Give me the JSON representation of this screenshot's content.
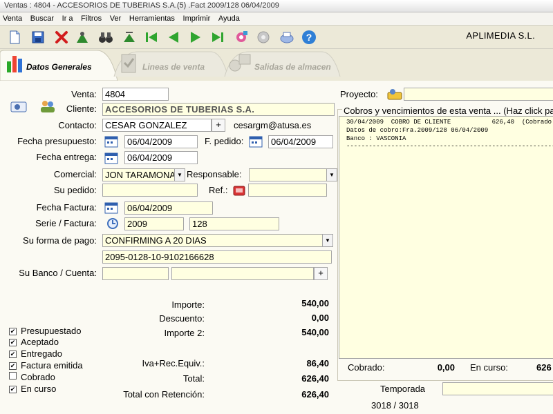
{
  "window": {
    "title": "Ventas : 4804 - ACCESORIOS DE TUBERIAS S.A.(5)    .Fact 2009/128 06/04/2009"
  },
  "menu": [
    "Venta",
    "Buscar",
    "Ir a",
    "Filtros",
    "Ver",
    "Herramientas",
    "Imprimir",
    "Ayuda"
  ],
  "toolbar": {
    "company": "APLIMEDIA S.L.",
    "buttons": [
      "new-document-icon",
      "save-icon",
      "delete-icon",
      "navigate-icon",
      "search-binoculars-icon",
      "go-icon",
      "first-record-icon",
      "previous-record-icon",
      "next-record-icon",
      "last-record-icon",
      "tools-icon",
      "settings-icon",
      "print-icon",
      "help-icon"
    ]
  },
  "tabs": [
    {
      "label": "Datos Generales",
      "active": true
    },
    {
      "label": "Lineas de venta",
      "active": false
    },
    {
      "label": "Salidas de almacen",
      "active": false
    }
  ],
  "form": {
    "venta_label": "Venta:",
    "venta": "4804",
    "cliente_label": "Cliente:",
    "cliente": "ACCESORIOS DE TUBERIAS S.A.",
    "contacto_label": "Contacto:",
    "contacto": "CESAR GONZALEZ",
    "contacto_plus": "+",
    "email": "cesargm@atusa.es",
    "fecha_presupuesto_label": "Fecha presupuesto:",
    "fecha_presupuesto": "06/04/2009",
    "fecha_pedido_label": "F. pedido:",
    "fecha_pedido": "06/04/2009",
    "fecha_entrega_label": "Fecha entrega:",
    "fecha_entrega": "06/04/2009",
    "comercial_label": "Comercial:",
    "comercial": "JON TARAMONA",
    "responsable_label": "Responsable:",
    "responsable": "",
    "su_pedido_label": "Su pedido:",
    "su_pedido": "",
    "ref_label": "Ref.:",
    "ref": "",
    "fecha_factura_label": "Fecha Factura:",
    "fecha_factura": "06/04/2009",
    "serie_factura_label": "Serie / Factura:",
    "serie": "2009",
    "factura": "128",
    "forma_pago_label": "Su forma de pago:",
    "forma_pago": "CONFIRMING A 20 DIAS",
    "cuenta_pago": "2095-0128-10-9102166628",
    "banco_label": "Su Banco / Cuenta:",
    "banco": "",
    "cuenta": "",
    "banco_plus": "+",
    "dropdown_arrow": "▼"
  },
  "totals": {
    "importe_label": "Importe:",
    "importe": "540,00",
    "descuento_label": "Descuento:",
    "descuento": "0,00",
    "importe2_label": "Importe 2:",
    "importe2": "540,00",
    "iva_label": "Iva+Rec.Equiv.:",
    "iva": "86,40",
    "total_label": "Total:",
    "total": "626,40",
    "total_ret_label": "Total con Retención:",
    "total_ret": "626,40"
  },
  "status_checks": [
    {
      "label": "Presupuestado",
      "checked": true,
      "mark": "✔"
    },
    {
      "label": "Aceptado",
      "checked": true,
      "mark": "✔"
    },
    {
      "label": "Entregado",
      "checked": true,
      "mark": "✔"
    },
    {
      "label": "Factura emitida",
      "checked": true,
      "mark": "✔"
    },
    {
      "label": "Cobrado",
      "checked": false,
      "mark": ""
    },
    {
      "label": "En curso",
      "checked": true,
      "mark": "✔"
    }
  ],
  "right": {
    "proyecto_label": "Proyecto:",
    "proyecto": "",
    "cobros_title": "Cobros y vencimientos de esta venta  ... (Haz click para",
    "cobros_lines": [
      "30/04/2009  COBRO DE CLIENTE           626,40  (Cobrado",
      "Datos de cobro:Fra.2009/128 06/04/2009",
      "Banco : VASCONIA",
      "------------------------------------------------------------"
    ],
    "cobrado_label": "Cobrado:",
    "cobrado": "0,00",
    "en_curso_label": "En curso:",
    "en_curso": "626",
    "temporada_label": "Temporada",
    "temporada": "",
    "record_counter": "3018 / 3018"
  }
}
